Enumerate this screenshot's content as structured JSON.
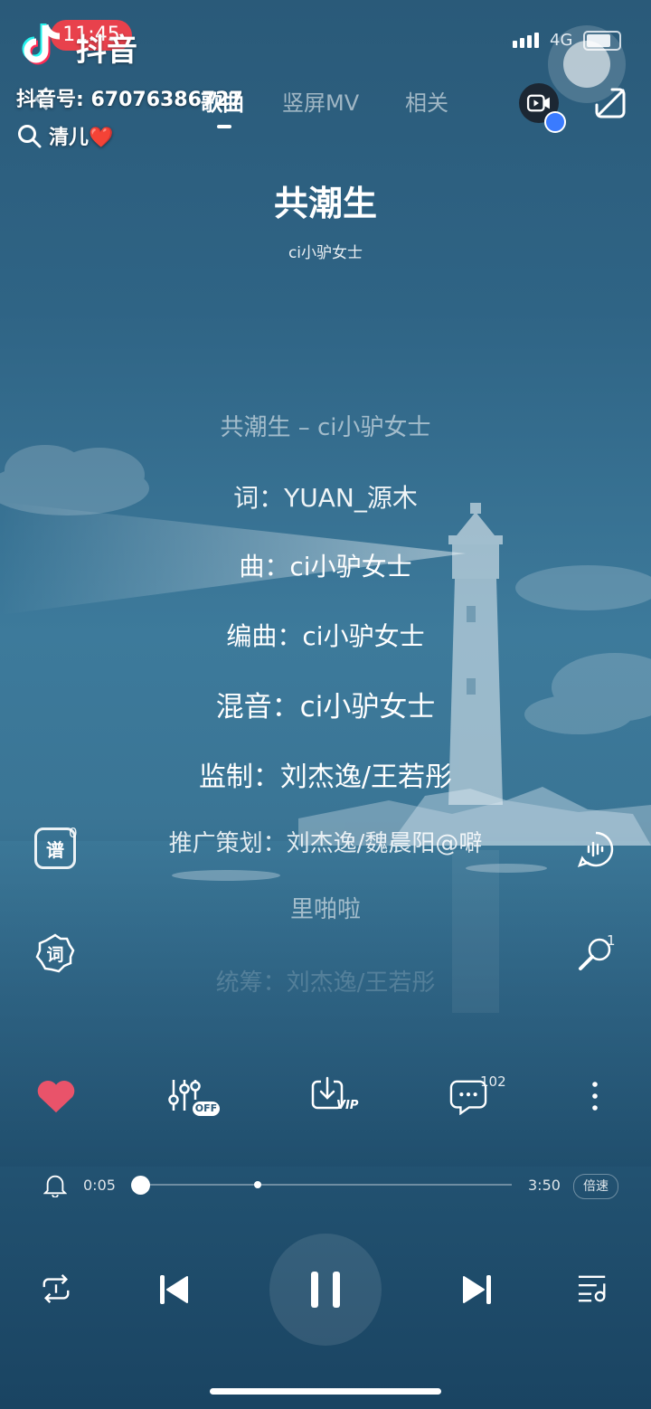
{
  "status_bar": {
    "time": "11:45",
    "network": "4G"
  },
  "watermark": {
    "app_name": "抖音",
    "account_id": "抖音号: 67076386727",
    "search_text": "清儿❤️"
  },
  "tabs": [
    {
      "label": "歌曲"
    },
    {
      "label": "竖屏MV"
    },
    {
      "label": "相关"
    }
  ],
  "song": {
    "title": "共潮生",
    "artist": "ci小驴女士"
  },
  "lyrics": [
    {
      "text": "共潮生 – ci小驴女士"
    },
    {
      "text": "词：YUAN_源木"
    },
    {
      "text": "曲：ci小驴女士"
    },
    {
      "text": "编曲：ci小驴女士"
    },
    {
      "text": "混音：ci小驴女士"
    },
    {
      "text": "监制：刘杰逸/王若彤"
    },
    {
      "text": "推广策划：刘杰逸/魏晨阳@噼"
    },
    {
      "text": "里啪啦"
    },
    {
      "text": "统筹：刘杰逸/王若彤"
    }
  ],
  "side_buttons": {
    "sheet_label": "谱",
    "sheet_count": "0",
    "lyric_label": "词",
    "karaoke_count": "1"
  },
  "actions": {
    "effect_badge": "OFF",
    "download_badge": "VIP",
    "comment_count": "102"
  },
  "progress": {
    "current": "0:05",
    "total": "3:50",
    "played_fraction": 0.022,
    "buffered_fraction": 0.33,
    "speed_label": "倍速"
  },
  "icons": {
    "like": "heart-icon",
    "effects": "equalizer-icon",
    "download": "download-icon",
    "comment": "comment-icon",
    "more": "more-icon",
    "loop": "loop-icon",
    "prev": "previous-icon",
    "pause": "pause-icon",
    "next": "next-icon",
    "playlist": "playlist-icon"
  },
  "colors": {
    "like": "#e9536a",
    "status_pill": "#e8414c"
  }
}
